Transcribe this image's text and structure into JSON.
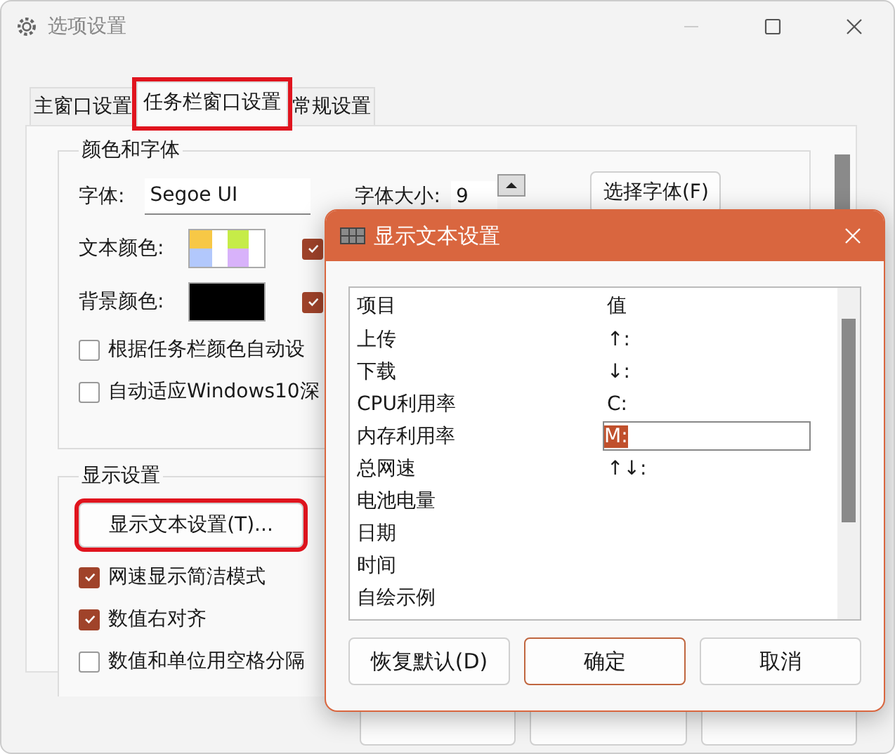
{
  "window": {
    "title": "选项设置"
  },
  "tabs": [
    {
      "label": "主窗口设置",
      "selected": false,
      "highlighted": false
    },
    {
      "label": "任务栏窗口设置",
      "selected": true,
      "highlighted": true
    },
    {
      "label": "常规设置",
      "selected": false,
      "highlighted": false
    }
  ],
  "color_font_group": {
    "title": "颜色和字体",
    "font_label": "字体:",
    "font_value": "Segoe UI",
    "size_label": "字体大小:",
    "size_value": "9",
    "choose_font_button": "选择字体(F)",
    "text_color_label": "文本颜色:",
    "text_color_checked": true,
    "bg_color_label": "背景颜色:",
    "bg_color_checked": true,
    "checkboxes": [
      {
        "label": "根据任务栏颜色自动设",
        "checked": false
      },
      {
        "label": "自动适应Windows10深",
        "checked": false
      }
    ]
  },
  "display_group": {
    "title": "显示设置",
    "button": {
      "label": "显示文本设置(T)...",
      "highlighted": true
    },
    "checkboxes": [
      {
        "label": "网速显示简洁模式",
        "checked": true
      },
      {
        "label": "数值右对齐",
        "checked": true
      },
      {
        "label": "数值和单位用空格分隔",
        "checked": false
      }
    ]
  },
  "dialog": {
    "title": "显示文本设置",
    "columns": [
      "项目",
      "值"
    ],
    "rows": [
      {
        "item": "上传",
        "value": "↑:",
        "editing": false
      },
      {
        "item": "下载",
        "value": "↓:",
        "editing": false
      },
      {
        "item": "CPU利用率",
        "value": "C:",
        "editing": false
      },
      {
        "item": "内存利用率",
        "value": "M:",
        "editing": true
      },
      {
        "item": "总网速",
        "value": "↑↓:",
        "editing": false
      },
      {
        "item": "电池电量",
        "editing": false
      },
      {
        "item": "日期",
        "editing": false
      },
      {
        "item": "时间",
        "editing": false
      },
      {
        "item": "自绘示例",
        "editing": false
      }
    ],
    "buttons": [
      {
        "label": "恢复默认(D)",
        "default": false
      },
      {
        "label": "确定",
        "default": true
      },
      {
        "label": "取消",
        "default": false
      }
    ]
  }
}
